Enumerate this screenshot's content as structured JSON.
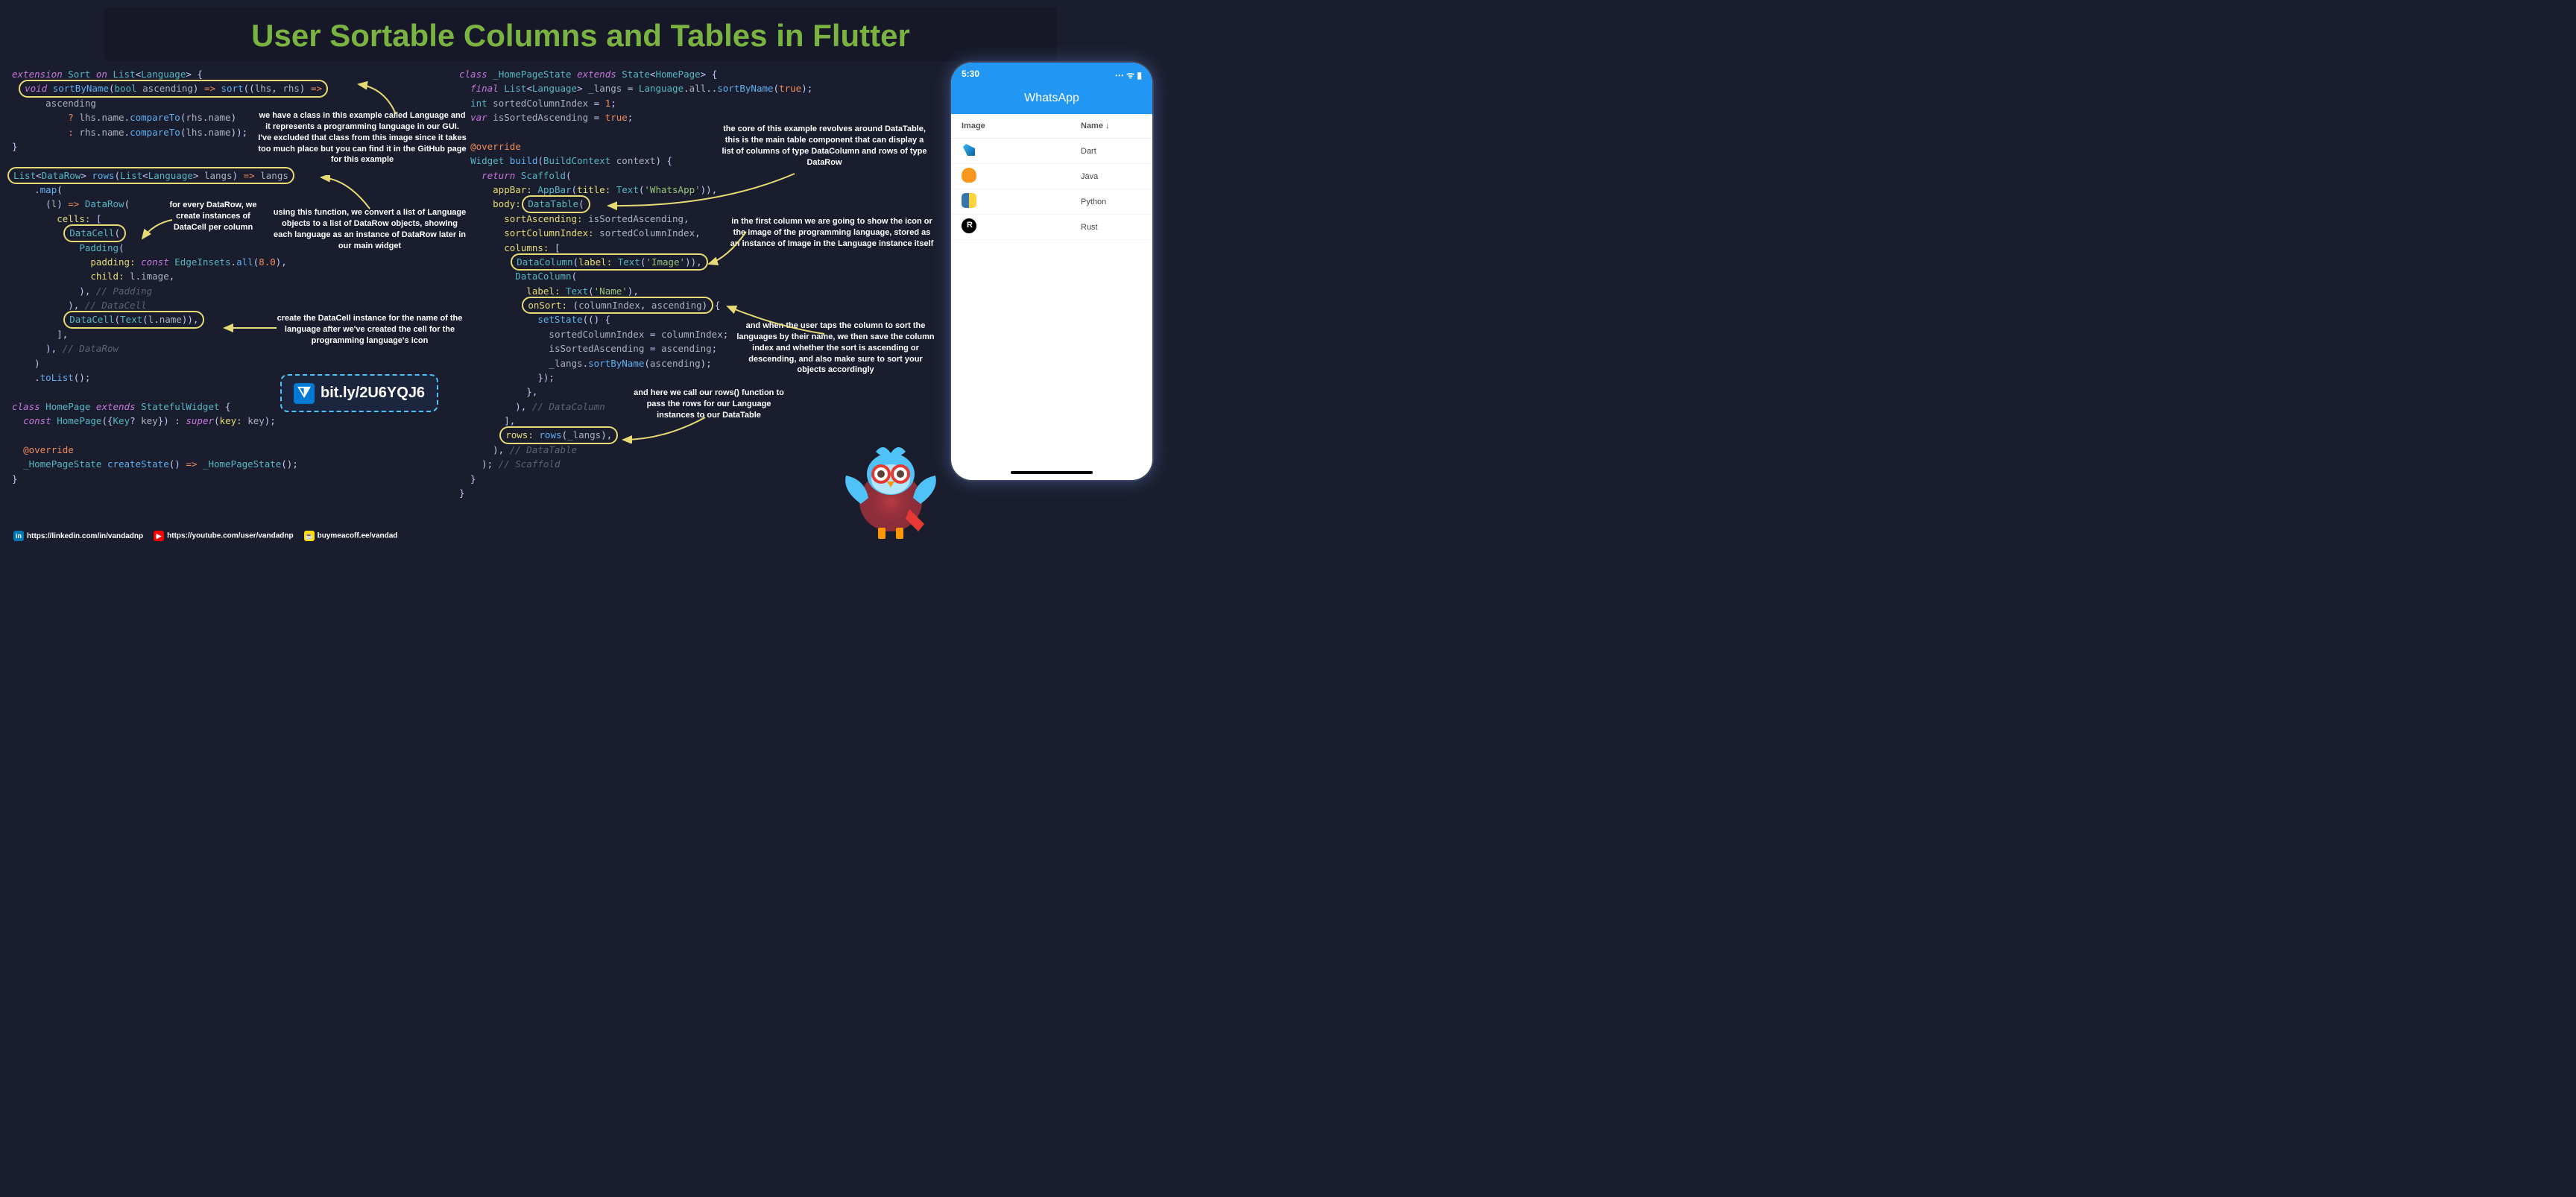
{
  "title": "User Sortable Columns and Tables in Flutter",
  "bitly": "bit.ly/2U6YQJ6",
  "socials": {
    "linkedin": "https://linkedin.com/in/vandadnp",
    "youtube": "https://youtube.com/user/vandadnp",
    "buymeacoffee": "buymeacoff.ee/vandad"
  },
  "annotations": {
    "a1": "we have a class in this example called Language and it represents a programming language in our GUI. I've excluded that class from this image since it takes too much place but you can find it in the GitHub page for this example",
    "a2": "for every DataRow, we create instances of DataCell per column",
    "a3": "using this function, we convert a list of Language objects to a list of DataRow objects, showing each language as an instance of DataRow later in our main widget",
    "a4": "create the DataCell instance for the name of the language after we've created the cell for the programming language's icon",
    "a5": "the core of this example revolves around DataTable, this is the main table component that can display a list of columns of type DataColumn and rows of type DataRow",
    "a6": "in the first column we are going to show the icon or the image of the programming language, stored as an instance of Image in the Language instance itself",
    "a7": "and when the user taps the column to sort the languages by their name, we then save the column index and whether the sort is ascending or descending, and also make sure to sort your objects accordingly",
    "a8": "and here we call our rows() function to pass the rows for our Language instances to our DataTable"
  },
  "code_left": {
    "l1": "extension Sort on List<Language> {",
    "l2": "  void sortByName(bool ascending) => sort((lhs, rhs) =>",
    "l3": "      ascending",
    "l4": "          ? lhs.name.compareTo(rhs.name)",
    "l5": "          : rhs.name.compareTo(lhs.name));",
    "l6": "}",
    "l7": "",
    "l8": "List<DataRow> rows(List<Language> langs) => langs",
    "l9": "    .map(",
    "l10": "      (l) => DataRow(",
    "l11": "        cells: [",
    "l12": "          DataCell(",
    "l13": "            Padding(",
    "l14": "              padding: const EdgeInsets.all(8.0),",
    "l15": "              child: l.image,",
    "l16": "            ), // Padding",
    "l17": "          ), // DataCell",
    "l18": "          DataCell(Text(l.name)),",
    "l19": "        ],",
    "l20": "      ), // DataRow",
    "l21": "    )",
    "l22": "    .toList();",
    "l23": "",
    "l24": "class HomePage extends StatefulWidget {",
    "l25": "  const HomePage({Key? key}) : super(key: key);",
    "l26": "",
    "l27": "  @override",
    "l28": "  _HomePageState createState() => _HomePageState();",
    "l29": "}"
  },
  "code_right": {
    "r1": "class _HomePageState extends State<HomePage> {",
    "r2": "  final List<Language> _langs = Language.all..sortByName(true);",
    "r3": "  int sortedColumnIndex = 1;",
    "r4": "  var isSortedAscending = true;",
    "r5": "",
    "r6": "  @override",
    "r7": "  Widget build(BuildContext context) {",
    "r8": "    return Scaffold(",
    "r9": "      appBar: AppBar(title: Text('WhatsApp')),",
    "r10": "      body: DataTable(",
    "r11": "        sortAscending: isSortedAscending,",
    "r12": "        sortColumnIndex: sortedColumnIndex,",
    "r13": "        columns: [",
    "r14": "          DataColumn(label: Text('Image')),",
    "r15": "          DataColumn(",
    "r16": "            label: Text('Name'),",
    "r17": "            onSort: (columnIndex, ascending) {",
    "r18": "              setState(() {",
    "r19": "                sortedColumnIndex = columnIndex;",
    "r20": "                isSortedAscending = ascending;",
    "r21": "                _langs.sortByName(ascending);",
    "r22": "              });",
    "r23": "            },",
    "r24": "          ), // DataColumn",
    "r25": "        ],",
    "r26": "        rows: rows(_langs),",
    "r27": "      ), // DataTable",
    "r28": "    ); // Scaffold",
    "r29": "  }",
    "r30": "}"
  },
  "phone": {
    "time": "5:30",
    "app_title": "WhatsApp",
    "headers": {
      "image": "Image",
      "name": "Name ↓"
    },
    "rows": [
      {
        "icon": "dart",
        "name": "Dart"
      },
      {
        "icon": "java",
        "name": "Java"
      },
      {
        "icon": "python",
        "name": "Python"
      },
      {
        "icon": "rust",
        "name": "Rust"
      }
    ]
  }
}
